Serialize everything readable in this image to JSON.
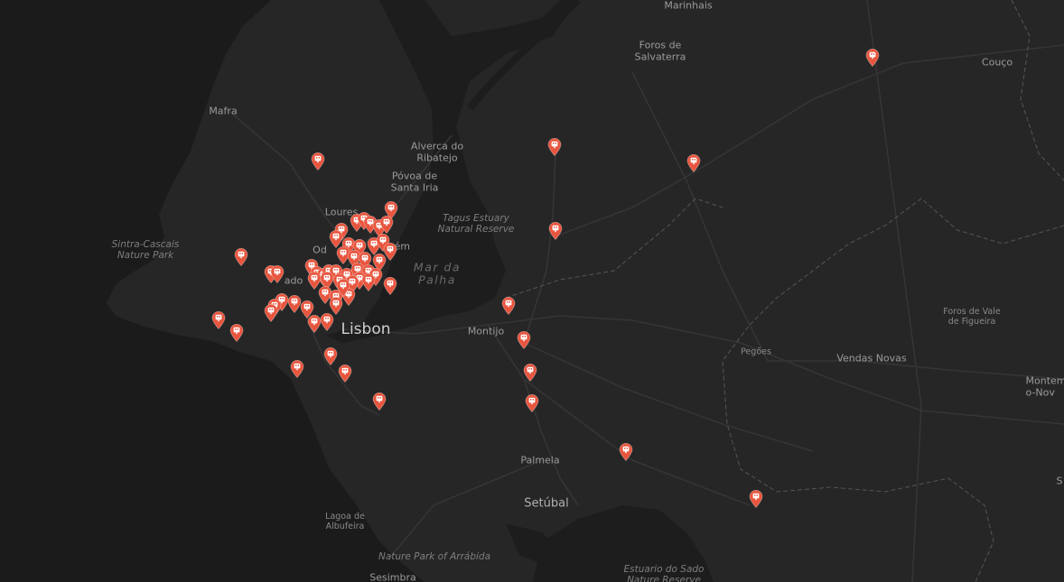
{
  "map": {
    "marker_color": "#e8553e",
    "marker_icon": "charging-station-icon",
    "labels": [
      {
        "id": "marinhais",
        "text": "Marinhais",
        "style": "town"
      },
      {
        "id": "foros-de-salvaterra",
        "text": "Foros de\nSalvaterra",
        "style": "town"
      },
      {
        "id": "couco",
        "text": "Couço",
        "style": "town"
      },
      {
        "id": "mafra",
        "text": "Mafra",
        "style": "town"
      },
      {
        "id": "alverca",
        "text": "Alverca do\nRibatejo",
        "style": "town"
      },
      {
        "id": "povoa",
        "text": "Póvoa de\nSanta Iria",
        "style": "town"
      },
      {
        "id": "loures",
        "text": "Loures",
        "style": "town"
      },
      {
        "id": "tagus-estuary",
        "text": "Tagus Estuary\nNatural Reserve",
        "style": "park"
      },
      {
        "id": "sintra-cascais",
        "text": "Sintra-Cascais\nNature Park",
        "style": "park"
      },
      {
        "id": "odivelas",
        "text": "Od",
        "style": "town"
      },
      {
        "id": "sacavem",
        "text": "vém",
        "style": "town"
      },
      {
        "id": "mar-da-palha",
        "text": "Mar da\nPalha",
        "style": "water"
      },
      {
        "id": "amadora",
        "text": "ado",
        "style": "town"
      },
      {
        "id": "lisbon",
        "text": "Lisbon",
        "style": "city"
      },
      {
        "id": "montijo",
        "text": "Montijo",
        "style": "town"
      },
      {
        "id": "pegoes",
        "text": "Pegões",
        "style": "small"
      },
      {
        "id": "vendas-novas",
        "text": "Vendas Novas",
        "style": "town"
      },
      {
        "id": "foros-de-vale",
        "text": "Foros de Vale\nde Figueira",
        "style": "small"
      },
      {
        "id": "montemor",
        "text": "Montem\no-Nov",
        "style": "town"
      },
      {
        "id": "palmela",
        "text": "Palmela",
        "style": "town"
      },
      {
        "id": "setubal",
        "text": "Setúbal",
        "style": "mid"
      },
      {
        "id": "lagoa",
        "text": "Lagoa de\nAlbufeira",
        "style": "small"
      },
      {
        "id": "arrabida",
        "text": "Nature Park of Arrábida",
        "style": "park"
      },
      {
        "id": "sesimbra",
        "text": "Sesimbra",
        "style": "town"
      },
      {
        "id": "estuario-sado",
        "text": "Estuario do Sado\nNature Reserve",
        "style": "park"
      },
      {
        "id": "edge-s",
        "text": "S",
        "style": "town"
      }
    ]
  }
}
